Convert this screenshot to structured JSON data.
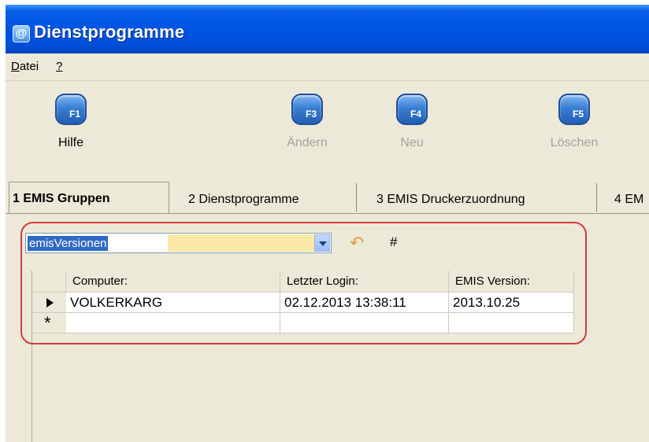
{
  "window": {
    "title": "Dienstprogramme",
    "app_icon": "at-icon",
    "titlebar_color": "#0055e4"
  },
  "menu": {
    "items": [
      {
        "label": "Datei",
        "accesskey": "D"
      },
      {
        "label": "?",
        "accesskey": "?"
      }
    ]
  },
  "toolbar": {
    "buttons": [
      {
        "key": "F1",
        "label": "Hilfe",
        "enabled": true
      },
      {
        "key": "F3",
        "label": "Ändern",
        "enabled": false
      },
      {
        "key": "F4",
        "label": "Neu",
        "enabled": false
      },
      {
        "key": "F5",
        "label": "Löschen",
        "enabled": false
      }
    ]
  },
  "tabs": [
    {
      "label": "1 EMIS Gruppen",
      "active": true
    },
    {
      "label": "2 Dienstprogramme",
      "active": false
    },
    {
      "label": "3 EMIS Druckerzuordnung",
      "active": false
    },
    {
      "label": "4 EM",
      "active": false
    }
  ],
  "query": {
    "selected_value": "emisVersionen",
    "undo_icon": "undo-arrow-icon",
    "hash_label": "#",
    "highlight_color": "#d23b3b"
  },
  "grid": {
    "columns": [
      "Computer:",
      "Letzter Login:",
      "EMIS Version:"
    ],
    "rows": [
      [
        "VOLKERKARG",
        "02.12.2013 13:38:11",
        "2013.10.25"
      ]
    ],
    "new_row_marker": "*"
  }
}
